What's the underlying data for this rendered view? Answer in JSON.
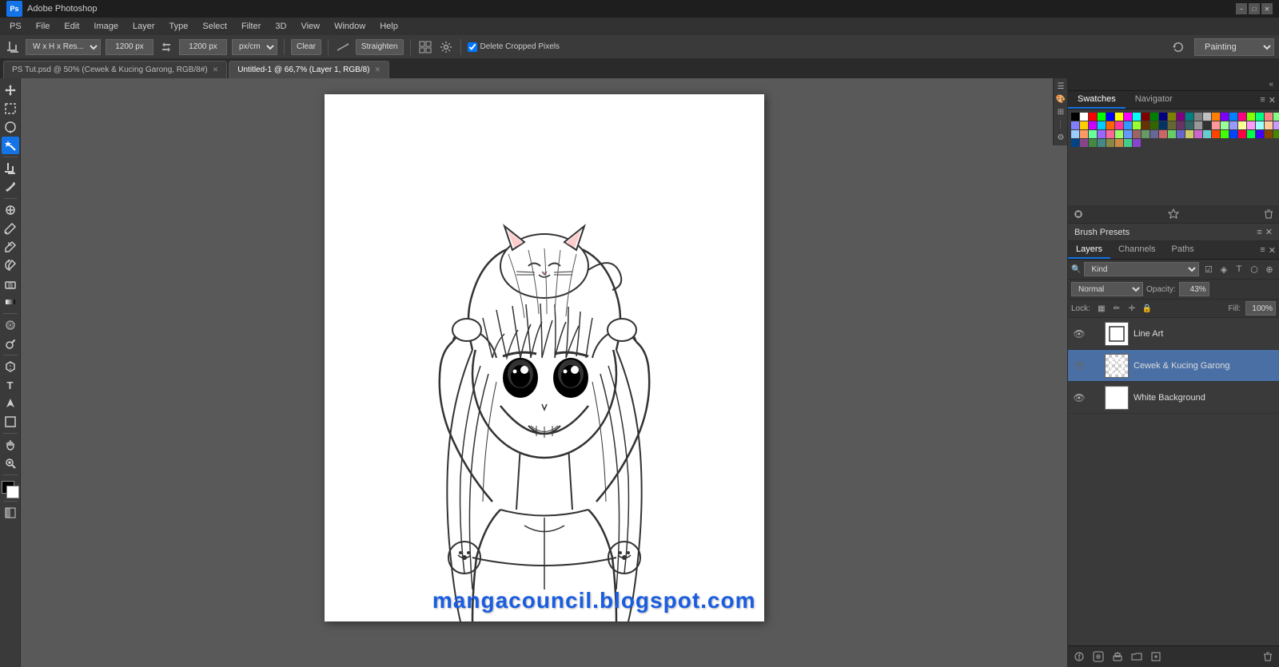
{
  "app": {
    "title": "Adobe Photoshop",
    "logo": "Ps"
  },
  "titlebar": {
    "title": "Adobe Photoshop",
    "minimize": "−",
    "restore": "□",
    "close": "✕"
  },
  "menubar": {
    "items": [
      "PS",
      "File",
      "Edit",
      "Image",
      "Layer",
      "Type",
      "Select",
      "Filter",
      "3D",
      "View",
      "Window",
      "Help"
    ]
  },
  "optionsbar": {
    "tool_dropdown": "W x H x Res...",
    "width_value": "1200 px",
    "height_value": "1200 px",
    "unit": "px/cm",
    "clear_btn": "Clear",
    "straighten_btn": "Straighten",
    "delete_cropped": "Delete Cropped Pixels",
    "workspace": "Painting"
  },
  "tabs": [
    {
      "id": "tab1",
      "label": "PS Tut.psd @ 50% (Cewek & Kucing Garong, RGB/8#)",
      "active": false
    },
    {
      "id": "tab2",
      "label": "Untitled-1 @ 66,7% (Layer 1, RGB/8)",
      "active": true
    }
  ],
  "canvas": {
    "watermark": "mangacouncil.blogspot.com"
  },
  "panels": {
    "swatches_tab": "Swatches",
    "navigator_tab": "Navigator",
    "brush_presets": "Brush Presets",
    "layers_tab": "Layers",
    "channels_tab": "Channels",
    "paths_tab": "Paths",
    "filter_label": "Kind",
    "blend_mode": "Normal",
    "opacity_label": "Opacity:",
    "opacity_value": "43%",
    "lock_label": "Lock:",
    "fill_label": "Fill:",
    "fill_value": "100%"
  },
  "layers": [
    {
      "name": "Line Art",
      "visible": true,
      "active": false,
      "type": "white"
    },
    {
      "name": "Cewek & Kucing Garong",
      "visible": false,
      "active": true,
      "type": "thumbnail"
    },
    {
      "name": "White Background",
      "visible": true,
      "active": false,
      "type": "white"
    }
  ],
  "tools": {
    "move": "↖",
    "marquee": "⬜",
    "lasso": "🗂",
    "wand": "✦",
    "crop": "⊞",
    "eyedropper": "✏",
    "heal": "⊕",
    "brush": "🖌",
    "clone": "✐",
    "history": "⊗",
    "eraser": "◻",
    "gradient": "▥",
    "blur": "◎",
    "dodge": "◑",
    "pen": "✒",
    "type": "T",
    "path_select": "↗",
    "shape": "⬡",
    "zoom": "🔍",
    "hand": "✋"
  },
  "swatches_colors": [
    "#000000",
    "#ffffff",
    "#ff0000",
    "#00ff00",
    "#0000ff",
    "#ffff00",
    "#ff00ff",
    "#00ffff",
    "#800000",
    "#008000",
    "#000080",
    "#808000",
    "#800080",
    "#008080",
    "#808080",
    "#c0c0c0",
    "#ff8000",
    "#8000ff",
    "#0080ff",
    "#ff0080",
    "#80ff00",
    "#00ff80",
    "#ff8080",
    "#80ff80",
    "#8080ff",
    "#ffcc00",
    "#cc00ff",
    "#00ccff",
    "#ff6600",
    "#ff3399",
    "#3399ff",
    "#99ff33",
    "#663300",
    "#336600",
    "#003366",
    "#666633",
    "#663366",
    "#336666",
    "#999999",
    "#333333",
    "#ff9999",
    "#99ff99",
    "#9999ff",
    "#ffff99",
    "#ff99ff",
    "#99ffff",
    "#ffcc99",
    "#cc99ff",
    "#99ccff",
    "#ff9966",
    "#66ff99",
    "#9966ff",
    "#ff6699",
    "#99ff66",
    "#6699ff",
    "#996666",
    "#669966",
    "#666699",
    "#cc6666",
    "#66cc66",
    "#6666cc",
    "#cccc66",
    "#cc66cc",
    "#66cccc",
    "#ff4400",
    "#44ff00",
    "#0044ff",
    "#ff0044",
    "#00ff44",
    "#4400ff",
    "#884400",
    "#448800",
    "#004488",
    "#884488",
    "#448844",
    "#448888",
    "#888844",
    "#cc8844",
    "#44cc88",
    "#8844cc"
  ]
}
